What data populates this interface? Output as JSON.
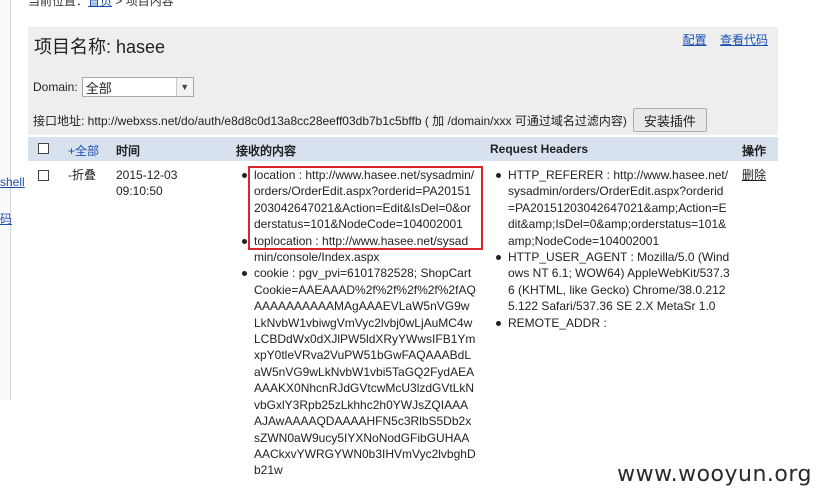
{
  "breadcrumb": {
    "prefix": "当前位置：",
    "home": "首页",
    "separator": " > ",
    "current": "项目内容"
  },
  "sidebar": {
    "link_shell": "shell",
    "link_code": "码"
  },
  "project": {
    "title": "项目名称: hasee",
    "config_link": "配置",
    "code_link": "查看代码"
  },
  "filter": {
    "domain_label": "Domain:",
    "domain_value": "全部"
  },
  "api": {
    "label": "接口地址: http://webxss.net/do/auth/e8d8c0d13a8cc28eeff03db7b1c5bffb ( 加 /domain/xxx 可通过域名过滤内容)",
    "install_button": "安装插件"
  },
  "table": {
    "headers": {
      "toggle_all": "+全部",
      "time": "时间",
      "content": "接收的内容",
      "request_headers": "Request Headers",
      "actions": "操作"
    },
    "row": {
      "toggle": "-折叠",
      "date": "2015-12-03",
      "clock": "09:10:50",
      "content": [
        "location : http://www.hasee.net/sysadmin/orders/OrderEdit.aspx?orderid=PA20151203042647021&Action=Edit&IsDel=0&orderstatus=101&NodeCode=104002001",
        "toplocation : http://www.hasee.net/sysadmin/console/Index.aspx",
        "cookie : pgv_pvi=6101782528; ShopCartCookie=AAEAAAD%2f%2f%2f%2f%2fAQAAAAAAAAAAMAgAAAEVLaW5nVG9wLkNvbW1vbiwgVmVyc2lvbj0wLjAuMC4wLCBDdWx0dXJlPW5ldXRyYWwsIFB1YmxpY0tleVRva2VuPW51bGwFAQAAABdLaW5nVG9wLkNvbW1vbi5TaGQ2FydAEAAAAKX0NhcnRJdGVtcwMcU3lzdGVtLkNvbGxlY3Rpb25zLkhhc2h0YWJsZQIAAAAJAwAAAAQDAAAAHFN5c3RlbS5Db2xsZWN0aW9ucy5IYXNoNodGFibGUHAAAACkxvYWRGYWN0b3IHVmVyc2lvbghDb21w"
      ],
      "headers": [
        "HTTP_REFERER : http://www.hasee.net/sysadmin/orders/OrderEdit.aspx?orderid=PA20151203042647021&amp;Action=Edit&amp;IsDel=0&amp;orderstatus=101&amp;NodeCode=104002001",
        "HTTP_USER_AGENT : Mozilla/5.0 (Windows NT 6.1; WOW64) AppleWebKit/537.36 (KHTML, like Gecko) Chrome/38.0.2125.122 Safari/537.36 SE 2.X MetaSr 1.0",
        "REMOTE_ADDR :"
      ],
      "delete": "删除"
    }
  },
  "watermark": "www.wooyun.org",
  "colors": {
    "link": "#1a4fb5",
    "panel_bg": "#eeeeee",
    "table_header_bg": "#d8e2ef",
    "highlight_border": "#d8262a"
  }
}
